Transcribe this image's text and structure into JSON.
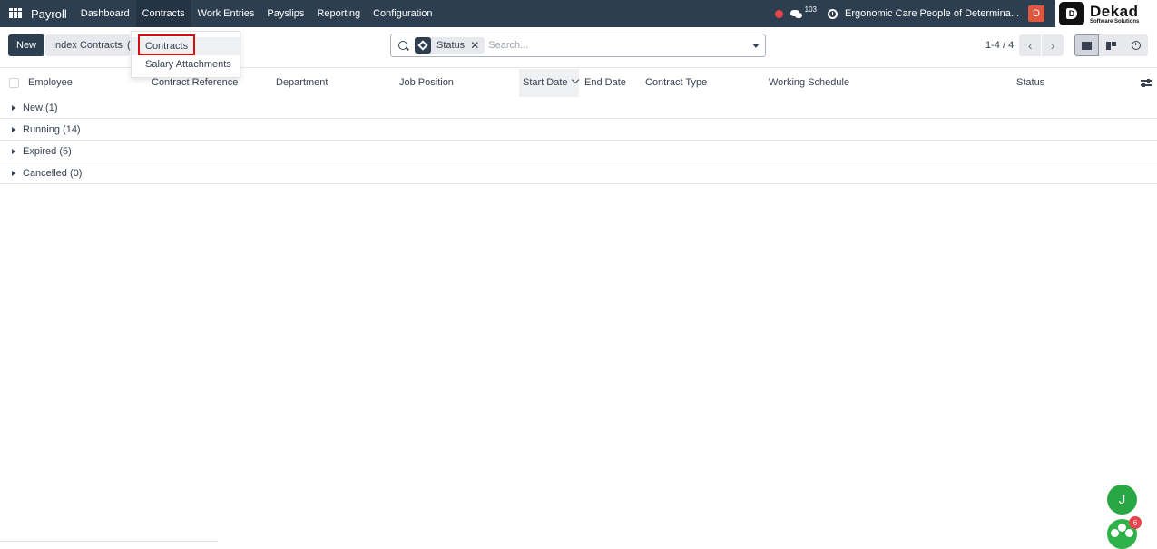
{
  "navbar": {
    "app_name": "Payroll",
    "menu": [
      "Dashboard",
      "Contracts",
      "Work Entries",
      "Payslips",
      "Reporting",
      "Configuration"
    ],
    "chat_count": "103",
    "company": "Ergonomic Care People of Determina...",
    "user_initial": "D",
    "brand_name": "Dekad",
    "brand_sub": "Software Solutions"
  },
  "control": {
    "new_label": "New",
    "index_label": "Index Contracts",
    "hidden_fragment": "(",
    "facet_label": "Status",
    "facet_remove": "✕",
    "search_placeholder": "Search...",
    "pager_value": "1-4 / 4",
    "pager_prev": "‹",
    "pager_next": "›"
  },
  "dropdown": {
    "items": [
      "Contracts",
      "Salary Attachments"
    ]
  },
  "table": {
    "columns": [
      "Employee",
      "Contract Reference",
      "Department",
      "Job Position",
      "Start Date",
      "End Date",
      "Contract Type",
      "Working Schedule",
      "Status"
    ],
    "groups": [
      "New (1)",
      "Running (14)",
      "Expired (5)",
      "Cancelled (0)"
    ]
  },
  "floating": {
    "chat_avatar": "J",
    "notif_count": "6"
  },
  "colors": {
    "navbar": "#2c3e50",
    "primary_button": "#2c3e50",
    "highlight_border": "#d40e0e",
    "avatar_user": "#e0573f",
    "chat_avatar": "#28a745",
    "badge": "#e8424b"
  },
  "icons": [
    "apps-icon",
    "chat-icon",
    "clock-icon",
    "search-icon",
    "layers-icon",
    "caret-down-icon",
    "list-view-icon",
    "kanban-view-icon",
    "activity-view-icon",
    "sort-down-icon",
    "optional-columns-icon",
    "caret-right-icon",
    "community-icon"
  ]
}
